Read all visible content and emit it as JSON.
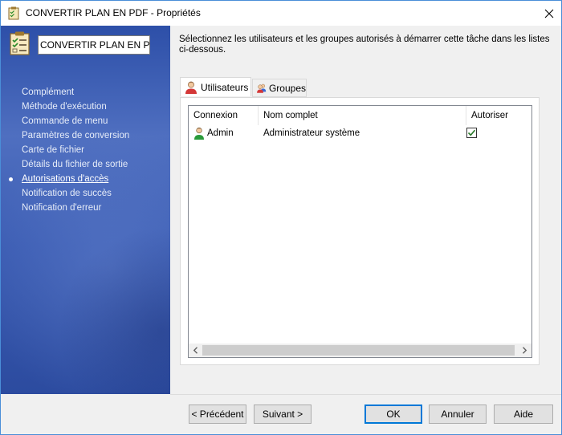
{
  "window": {
    "title": "CONVERTIR PLAN EN PDF - Propriétés"
  },
  "sidebar": {
    "task_name": "CONVERTIR PLAN EN PDF",
    "items": [
      {
        "label": "Complément"
      },
      {
        "label": "Méthode d'exécution"
      },
      {
        "label": "Commande de menu"
      },
      {
        "label": "Paramètres de conversion"
      },
      {
        "label": "Carte de fichier"
      },
      {
        "label": "Détails du fichier de sortie"
      },
      {
        "label": "Autorisations d'accès",
        "active": true
      },
      {
        "label": "Notification de succès"
      },
      {
        "label": "Notification d'erreur"
      }
    ]
  },
  "main": {
    "description": "Sélectionnez les utilisateurs et les groupes autorisés à démarrer cette tâche dans les listes ci-dessous.",
    "tabs": [
      {
        "label": "Utilisateurs",
        "active": true
      },
      {
        "label": "Groupes",
        "active": false
      }
    ],
    "table": {
      "columns": [
        "Connexion",
        "Nom complet",
        "Autoriser"
      ],
      "rows": [
        {
          "login": "Admin",
          "full_name": "Administrateur système",
          "allowed": true
        }
      ]
    }
  },
  "buttons": {
    "previous": "< Précédent",
    "next": "Suivant >",
    "ok": "OK",
    "cancel": "Annuler",
    "help": "Aide"
  },
  "colors": {
    "sidebar_gradient_top": "#2d4fa8",
    "sidebar_gradient_bottom": "#2c4b9f",
    "accent": "#0078d7",
    "checkbox_check": "#2a7a2a"
  }
}
